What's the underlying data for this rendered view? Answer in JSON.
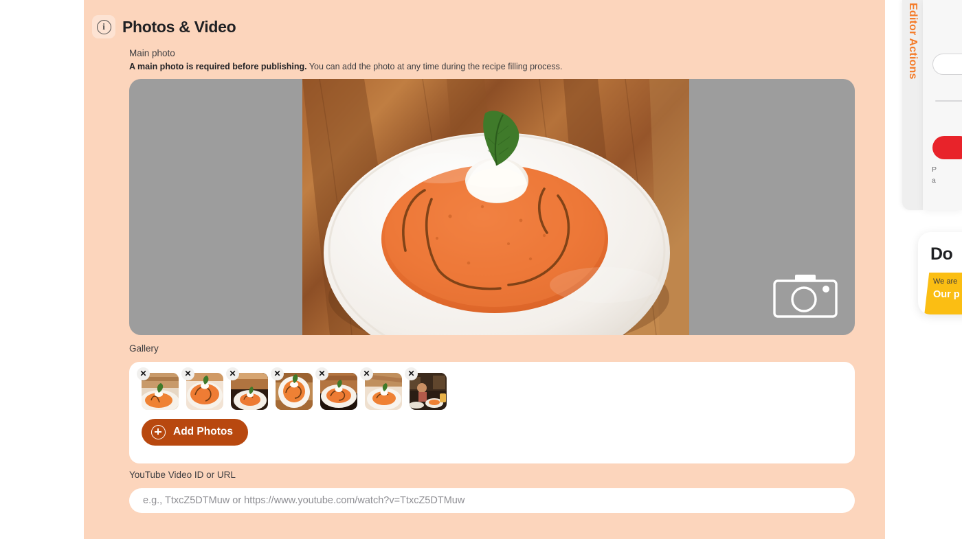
{
  "section": {
    "title": "Photos & Video",
    "info_icon": "info-circle-icon",
    "info_glyph": "i"
  },
  "main_photo": {
    "label": "Main photo",
    "hint_bold": "A main photo is required before publishing.",
    "hint_rest": " You can add the photo at any time during the recipe filling process.",
    "camera_icon": "camera-icon",
    "photo_alt": "Bowl of creamy tomato soup with basil leaf, cream dollop and balsamic drizzle on a wooden table",
    "letterbox_color": "#9d9d9d"
  },
  "gallery": {
    "label": "Gallery",
    "remove_glyph": "✕",
    "add_button_label": "Add Photos",
    "add_button_icon": "plus-circle-icon",
    "add_button_color": "#b8480f",
    "thumbnails": [
      {
        "alt": "Soup bowl close-up with basil, bright background"
      },
      {
        "alt": "Soup bowl overhead on light surface"
      },
      {
        "alt": "Soup bowl on dark wooden table with cutlery"
      },
      {
        "alt": "Soup bowl straight overhead on wood"
      },
      {
        "alt": "Soup bowl angled on dark wood"
      },
      {
        "alt": "Soup bowl on light wooden table"
      },
      {
        "alt": "Restaurant interior with served soup"
      }
    ]
  },
  "youtube": {
    "label": "YouTube Video ID or URL",
    "value": "",
    "placeholder": "e.g., TtxcZ5DTMuw or https://www.youtube.com/watch?v=TtxcZ5DTMuw"
  },
  "right_rail": {
    "tab_label": "Editor Actions",
    "tab_label_color": "#f47b28",
    "note_line1": "P",
    "note_line2": "a"
  },
  "promo": {
    "title": "Do",
    "ribbon_line1": "We are",
    "ribbon_line2": "Our p",
    "ribbon_color": "#fbbe13"
  },
  "theme": {
    "panel_background": "#fcd5bc",
    "page_background": "#ffffff",
    "accent": "#b8480f"
  }
}
